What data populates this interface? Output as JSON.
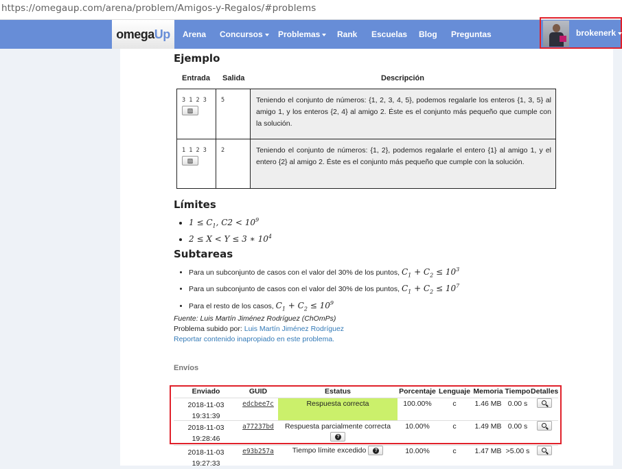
{
  "browser": {
    "url": "https://omegaup.com/arena/problem/Amigos-y-Regalos/#problems"
  },
  "navbar": {
    "brand": {
      "part1": "omega",
      "part2": "Up"
    },
    "items": [
      {
        "label": "Arena",
        "dropdown": false
      },
      {
        "label": "Concursos",
        "dropdown": true
      },
      {
        "label": "Problemas",
        "dropdown": true
      },
      {
        "label": "Rank",
        "dropdown": false
      },
      {
        "label": "Escuelas",
        "dropdown": false
      },
      {
        "label": "Blog",
        "dropdown": false
      },
      {
        "label": "Preguntas",
        "dropdown": false
      }
    ],
    "user": {
      "name": "brokenerk"
    },
    "colors": {
      "bar": "#678dd7",
      "highlight": "#e0202a"
    }
  },
  "ejemplo": {
    "title": "Ejemplo",
    "headers": {
      "entrada": "Entrada",
      "salida": "Salida",
      "descripcion": "Descripción"
    },
    "rows": [
      {
        "input": "3 1 2 3",
        "output": "5",
        "description": "Teniendo el conjunto de números: {1, 2, 3, 4, 5}, podemos regalarle los enteros {1, 3, 5} al amigo 1, y los enteros {2, 4} al amigo 2. Éste es el conjunto más pequeño que cumple con la solución."
      },
      {
        "input": "1 1 2 3",
        "output": "2",
        "description": "Teniendo el conjunto de números: {1, 2}, podemos regalarle el entero {1} al amigo 1, y el entero {2} al amigo 2. Éste es el conjunto más pequeño que cumple con la solución."
      }
    ]
  },
  "limites": {
    "title": "Límites"
  },
  "subtareas": {
    "title": "Subtareas",
    "items": [
      {
        "text": "Para un subconjunto de casos con el valor del 30% de los puntos,"
      },
      {
        "text": "Para un subconjunto de casos con el valor del 30% de los puntos,"
      },
      {
        "text": "Para el resto de los casos,"
      }
    ]
  },
  "meta": {
    "fuente": "Fuente: Luis Martín Jiménez Rodríguez (ChOmPs)",
    "subido_label": "Problema subido por:",
    "subido_autor": "Luis Martín Jiménez Rodríguez",
    "reportar": "Reportar contenido inapropiado en este problema."
  },
  "envios": {
    "title": "Envíos",
    "headers": [
      "Enviado",
      "GUID",
      "Estatus",
      "Porcentaje",
      "Lenguaje",
      "Memoria",
      "Tiempo",
      "Detalles"
    ],
    "rows": [
      {
        "date": "2018-11-03",
        "time": "19:31:39",
        "guid": "edcbee7c",
        "status": "Respuesta correcta",
        "percent": "100.00%",
        "lang": "c",
        "mem": "1.46 MB",
        "tiempo": "0.00 s"
      },
      {
        "date": "2018-11-03",
        "time": "19:28:46",
        "guid": "a77237bd",
        "status": "Respuesta parcialmente correcta",
        "percent": "10.00%",
        "lang": "c",
        "mem": "1.49 MB",
        "tiempo": "0.00 s"
      },
      {
        "date": "2018-11-03",
        "time": "19:27:33",
        "guid": "e93b257a",
        "status": "Tiempo límite excedido",
        "percent": "10.00%",
        "lang": "c",
        "mem": "1.47 MB",
        "tiempo": ">5.00 s"
      }
    ],
    "colors": {
      "correct": "#cbf06b"
    }
  }
}
